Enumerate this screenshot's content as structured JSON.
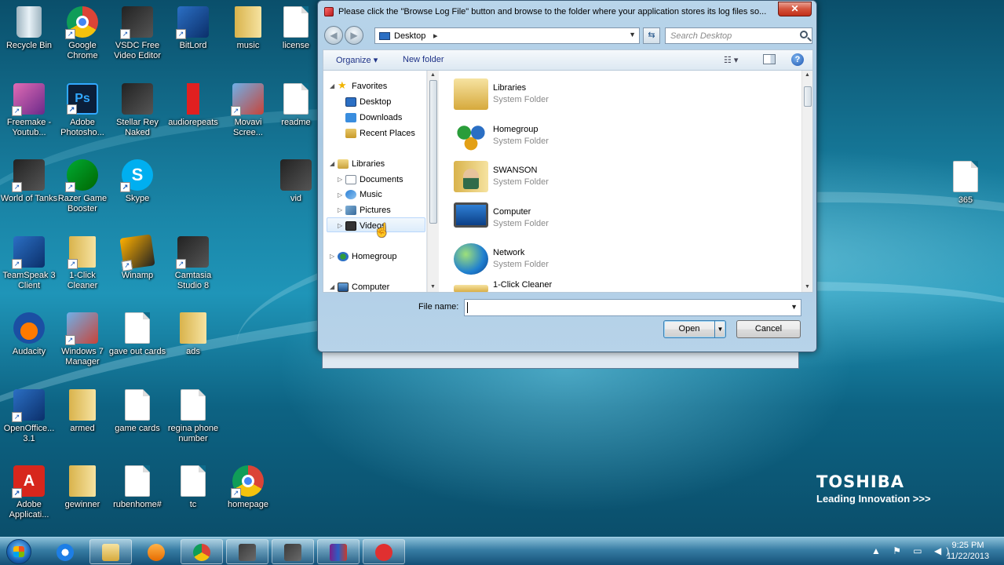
{
  "brand": {
    "name": "TOSHIBA",
    "tagline": "Leading Innovation >>>"
  },
  "desktop_icons": [
    {
      "label": "Recycle Bin",
      "icon": "recycle-bin-icon"
    },
    {
      "label": "Google Chrome",
      "icon": "chrome-icon"
    },
    {
      "label": "VSDC Free Video Editor",
      "icon": "video-editor-icon"
    },
    {
      "label": "BitLord",
      "icon": "bitlord-icon"
    },
    {
      "label": "music",
      "icon": "folder-icon"
    },
    {
      "label": "license",
      "icon": "document-icon"
    },
    {
      "label": "Freemake - Youtub...",
      "icon": "freemake-icon"
    },
    {
      "label": "Adobe Photosho...",
      "icon": "photoshop-icon"
    },
    {
      "label": "Stellar Rey Naked",
      "icon": "image-icon"
    },
    {
      "label": "audiorepeats",
      "icon": "audio-icon"
    },
    {
      "label": "Movavi Scree...",
      "icon": "movavi-icon"
    },
    {
      "label": "readme",
      "icon": "document-icon"
    },
    {
      "label": "World of Tanks",
      "icon": "tanks-icon"
    },
    {
      "label": "Razer Game Booster",
      "icon": "razer-icon"
    },
    {
      "label": "Skype",
      "icon": "skype-icon"
    },
    {
      "label": "vid",
      "icon": "video-icon"
    },
    {
      "label": "TeamSpeak 3 Client",
      "icon": "teamspeak-icon"
    },
    {
      "label": "1-Click Cleaner",
      "icon": "cleaner-icon"
    },
    {
      "label": "Winamp",
      "icon": "winamp-icon"
    },
    {
      "label": "Camtasia Studio 8",
      "icon": "camtasia-icon"
    },
    {
      "label": "Audacity",
      "icon": "audacity-icon"
    },
    {
      "label": "Windows 7 Manager",
      "icon": "win7-manager-icon"
    },
    {
      "label": "gave out cards",
      "icon": "document-icon"
    },
    {
      "label": "ads",
      "icon": "folder-icon"
    },
    {
      "label": "OpenOffice... 3.1",
      "icon": "openoffice-icon"
    },
    {
      "label": "armed",
      "icon": "folder-icon"
    },
    {
      "label": "game cards",
      "icon": "document-icon"
    },
    {
      "label": "regina phone number",
      "icon": "document-icon"
    },
    {
      "label": "Adobe Applicati...",
      "icon": "adobe-icon"
    },
    {
      "label": "gewinner",
      "icon": "folder-icon"
    },
    {
      "label": "rubenhome#",
      "icon": "document-icon"
    },
    {
      "label": "tc",
      "icon": "document-icon"
    },
    {
      "label": "homepage",
      "icon": "chrome-icon"
    },
    {
      "label": "365",
      "icon": "document-icon"
    }
  ],
  "dialog": {
    "title": "Please click the \"Browse Log File\" button and browse to the folder where your application stores its log files so...",
    "close_label": "✕",
    "address": "Desktop",
    "address_sep": "▸",
    "search_placeholder": "Search Desktop",
    "toolbar": {
      "organize": "Organize ▾",
      "new_folder": "New folder",
      "view": "☷ ▾",
      "help": "?"
    },
    "nav_tree": [
      {
        "label": "Favorites",
        "icon": "star-icon"
      },
      {
        "label": "Desktop",
        "icon": "desktop-icon"
      },
      {
        "label": "Downloads",
        "icon": "downloads-icon"
      },
      {
        "label": "Recent Places",
        "icon": "recent-places-icon"
      },
      {
        "label": "Libraries",
        "icon": "libraries-icon"
      },
      {
        "label": "Documents",
        "icon": "documents-icon"
      },
      {
        "label": "Music",
        "icon": "music-icon"
      },
      {
        "label": "Pictures",
        "icon": "pictures-icon"
      },
      {
        "label": "Videos",
        "icon": "videos-icon"
      },
      {
        "label": "Homegroup",
        "icon": "homegroup-icon"
      },
      {
        "label": "Computer",
        "icon": "computer-icon"
      }
    ],
    "files": [
      {
        "name": "Libraries",
        "type": "System Folder"
      },
      {
        "name": "Homegroup",
        "type": "System Folder"
      },
      {
        "name": "SWANSON",
        "type": "System Folder"
      },
      {
        "name": "Computer",
        "type": "System Folder"
      },
      {
        "name": "Network",
        "type": "System Folder"
      },
      {
        "name": "1-Click Cleaner",
        "type": ""
      }
    ],
    "filename_label": "File name:",
    "filename_value": "",
    "open_label": "Open",
    "cancel_label": "Cancel"
  },
  "taskbar": {
    "apps": [
      "internet-explorer-icon",
      "explorer-icon",
      "media-player-icon",
      "chrome-icon",
      "camtasia-icon",
      "camtasia-recorder-icon",
      "winrar-icon",
      "app-icon"
    ],
    "clock_time": "9:25 PM",
    "clock_date": "11/22/2013",
    "tray": "▲ ⚑ ▭ ◀)"
  }
}
